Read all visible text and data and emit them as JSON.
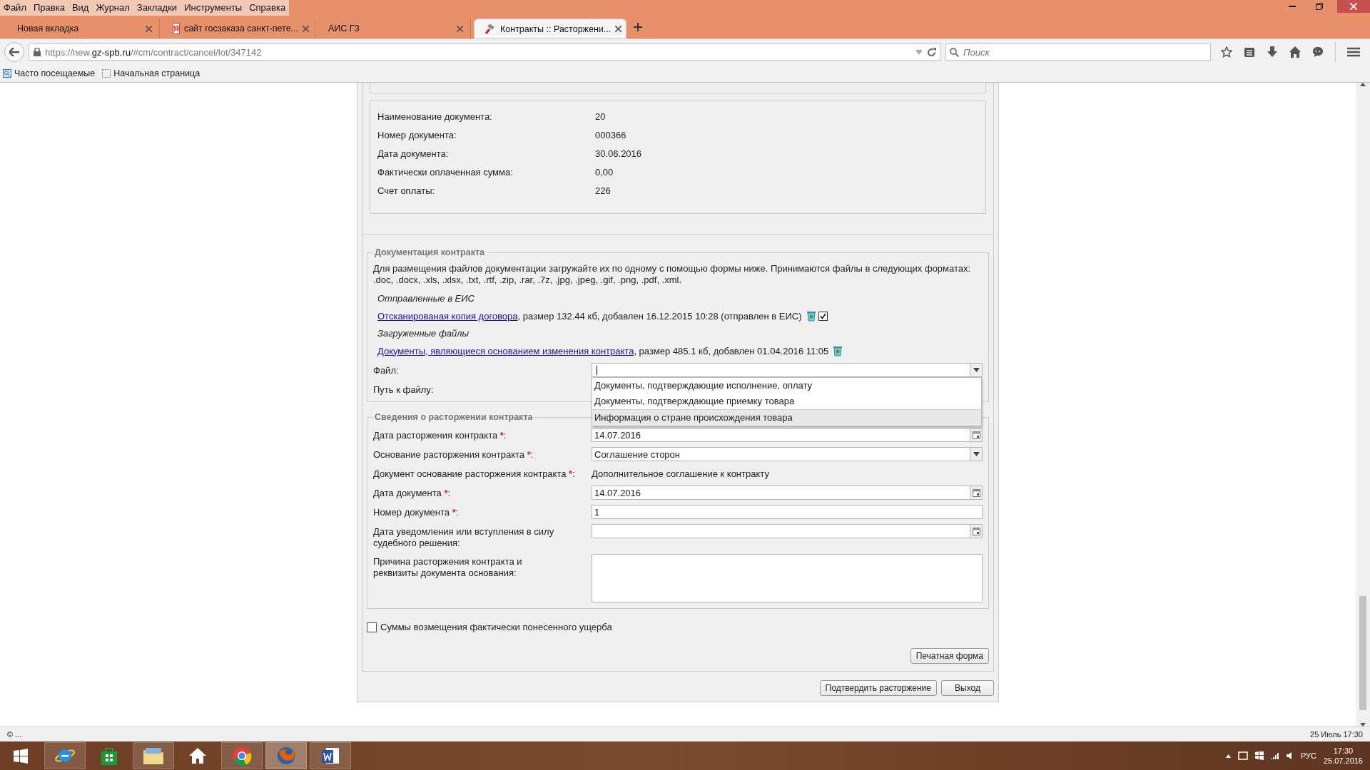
{
  "menu": [
    "Файл",
    "Правка",
    "Вид",
    "Журнал",
    "Закладки",
    "Инструменты",
    "Справка"
  ],
  "tabs": [
    {
      "label": "Новая вкладка",
      "kind": "plain",
      "selected": false
    },
    {
      "label": "сайт госзаказа санкт-пете...",
      "kind": "letter",
      "icon_letter": "Я",
      "selected": false
    },
    {
      "label": "АИС ГЗ",
      "kind": "plain",
      "selected": false
    },
    {
      "label": "Контракты :: Расторжени...",
      "kind": "gavel",
      "selected": true
    }
  ],
  "address_bar": {
    "url": "https://new.**gz-spb.ru**/#cm/contract/cancel/lot/347142"
  },
  "search": {
    "placeholder": "Поиск"
  },
  "bookmarks": [
    "Часто посещаемые",
    "Начальная страница"
  ],
  "payment_document": {
    "fields": [
      {
        "label": "Наименование документа:",
        "value": "20"
      },
      {
        "label": "Номер документа:",
        "value": "000366"
      },
      {
        "label": "Дата документа:",
        "value": "30.06.2016"
      },
      {
        "label": "Фактически оплаченная сумма:",
        "value": "0,00"
      },
      {
        "label": "Счет оплаты:",
        "value": "226"
      }
    ]
  },
  "documentation": {
    "legend": "Документация контракта",
    "intro": "Для размещения файлов документации загружайте их по одному с помощью формы ниже. Принимаются файлы в следующих форматах: .doc, .docx, .xls, .xlsx, .txt, .rtf, .zip, .rar, .7z, .jpg, .jpeg, .gif, .png, .pdf, .xml.",
    "sent_heading": "Отправленные в ЕИС",
    "sent_files": [
      {
        "link": "Отсканированая копия договора",
        "details": ", размер 132.44 кб, добавлен 16.12.2015 10:28 (отправлен в ЕИС)",
        "sent_checked": true
      }
    ],
    "uploaded_heading": "Загруженные файлы",
    "uploaded_files": [
      {
        "link": "Документы, являющиеся основанием изменения контракта",
        "details": ", размер 485.1 кб, добавлен 01.04.2016 11:05"
      }
    ],
    "file_label": "Файл:",
    "path_label": "Путь к файлу:",
    "file_dropdown": {
      "expanded": true,
      "options": [
        {
          "label": "Документы, подтверждающие исполнение, оплату",
          "selected": false
        },
        {
          "label": "Документы, подтверждающие приемку товара",
          "selected": false
        },
        {
          "label": "Информация о стране происхождения товара",
          "selected": true
        }
      ]
    }
  },
  "termination": {
    "legend": "Сведения о расторжении контракта",
    "fields": [
      {
        "kind": "date",
        "label": "Дата расторжения контракта ",
        "required_mark": "*",
        "label_end": ":",
        "value": "14.07.2016"
      },
      {
        "kind": "select",
        "label": "Основание расторжения контракта ",
        "required_mark": "*",
        "label_end": ":",
        "value": "Соглашение сторон"
      },
      {
        "kind": "text",
        "label": "Документ основание расторжения контракта ",
        "required_mark": "*",
        "label_end": ":",
        "value": "Дополнительное соглашение к контракту"
      },
      {
        "kind": "date",
        "label": "Дата документа ",
        "required_mark": "*",
        "label_end": ":",
        "value": "14.07.2016"
      },
      {
        "kind": "input",
        "label": "Номер документа ",
        "required_mark": "*",
        "label_end": ":",
        "value": "1"
      },
      {
        "kind": "date",
        "label": "Дата уведомления или вступления в силу судебного решения:"
      },
      {
        "kind": "textarea",
        "label": "Причина расторжения контракта и реквизиты документа основания:"
      }
    ]
  },
  "damages": {
    "label": "Суммы возмещения фактически понесенного ущерба",
    "checked": false
  },
  "print_button": "Печатная форма",
  "buttons": [
    "Подтвердить расторжение",
    "Выход"
  ],
  "status_bar": {
    "left": "© ...",
    "right": "25 Июль 17:30"
  },
  "taskbar": {
    "apps": [
      {
        "kind": "start",
        "running": false,
        "active": false
      },
      {
        "kind": "ie",
        "running": true,
        "active": false
      },
      {
        "kind": "store",
        "running": false,
        "active": false
      },
      {
        "kind": "explorer",
        "running": true,
        "active": false
      },
      {
        "kind": "home",
        "running": false,
        "active": false
      },
      {
        "kind": "chrome",
        "running": true,
        "active": false
      },
      {
        "kind": "firefox",
        "running": true,
        "active": true
      },
      {
        "kind": "word",
        "running": true,
        "active": false
      }
    ],
    "language": "РУС",
    "time": "17:30",
    "date": "25.07.2016"
  }
}
